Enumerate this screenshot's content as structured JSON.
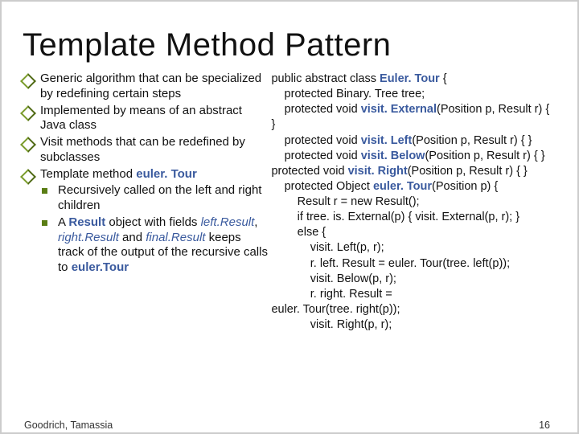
{
  "title": "Template Method Pattern",
  "bullets": {
    "b1": "Generic algorithm that can be specialized by redefining certain steps",
    "b2": "Implemented by means of an abstract Java class",
    "b3": "Visit methods that can be redefined by subclasses",
    "b4_prefix": "Template method ",
    "b4_method": "euler. Tour",
    "s1": "Recursively called on the left and right children",
    "s2_a": "A ",
    "s2_b": "Result",
    "s2_c": " object with fields ",
    "s2_d": "left.Result",
    "s2_e": ", ",
    "s2_f": "right.Result",
    "s2_g": " and ",
    "s2_h": "final.Result",
    "s2_i": " keeps track of the output of the recursive calls to ",
    "s2_j": "euler.Tour"
  },
  "code": {
    "l1a": "public abstract class ",
    "l1b": "Euler. Tour",
    "l1c": " {",
    "l2": "    protected Binary. Tree tree;",
    "l3a": "    protected void ",
    "l3b": "visit. External",
    "l3c": "(Position p, Result r) { }",
    "l4a": "    protected void ",
    "l4b": "visit. Left",
    "l4c": "(Position p, Result r) { }",
    "l5a": "    protected void ",
    "l5b": "visit. Below",
    "l5c": "(Position p, Result r) { }   protected void ",
    "l5d": "visit. Right",
    "l5e": "(Position p, Result r) { }",
    "l6a": "    protected Object ",
    "l6b": "euler. Tour",
    "l6c": "(Position p) {",
    "l7": "        Result r = new Result();",
    "l8": "        if tree. is. External(p) { visit. External(p, r); }",
    "l9": "        else {",
    "l10": "            visit. Left(p, r);",
    "l11": "            r. left. Result = euler. Tour(tree. left(p));",
    "l12": "            visit. Below(p, r);",
    "l13": "            r. right. Result =",
    "l14": "euler. Tour(tree. right(p));",
    "l15": "            visit. Right(p, r);"
  },
  "footer": "Goodrich, Tamassia",
  "page": "16"
}
